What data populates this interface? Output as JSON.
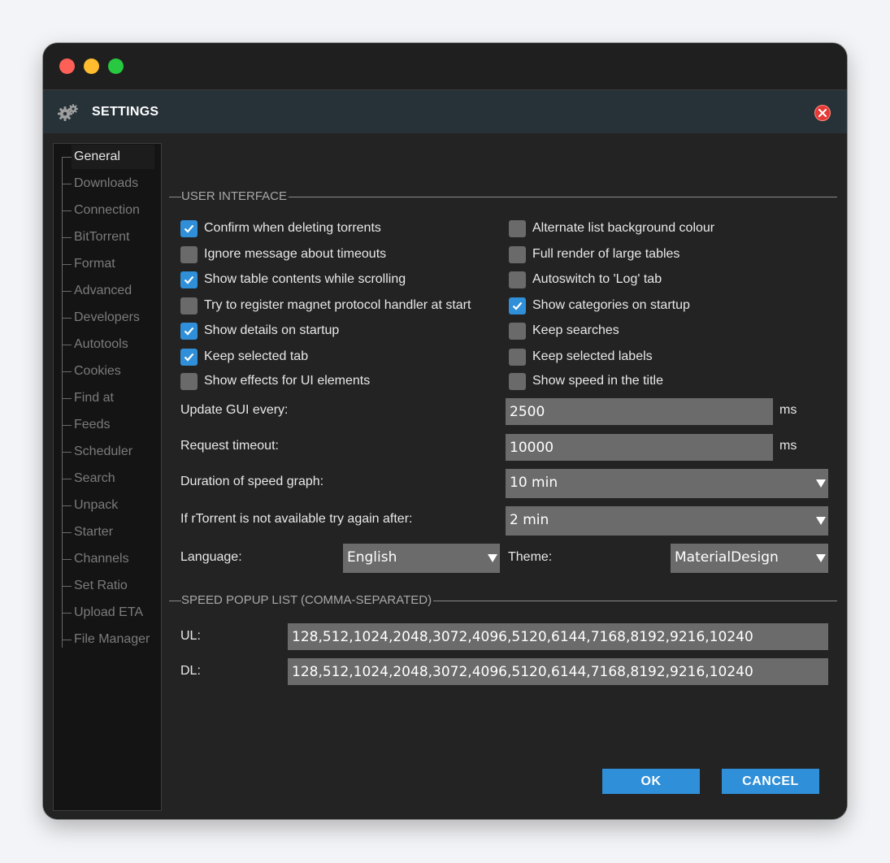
{
  "dialog": {
    "title": "SETTINGS"
  },
  "sidebar": {
    "items": [
      "General",
      "Downloads",
      "Connection",
      "BitTorrent",
      "Format",
      "Advanced",
      "Developers",
      "Autotools",
      "Cookies",
      "Find at",
      "Feeds",
      "Scheduler",
      "Search",
      "Unpack",
      "Starter",
      "Channels",
      "Set Ratio",
      "Upload ETA",
      "File Manager"
    ],
    "active": "General"
  },
  "user_interface": {
    "title": "USER INTERFACE",
    "left": [
      {
        "label": "Confirm when deleting torrents",
        "checked": true
      },
      {
        "label": "Ignore message about timeouts",
        "checked": false
      },
      {
        "label": "Show table contents while scrolling",
        "checked": true
      },
      {
        "label": "Try to register magnet protocol handler at start",
        "checked": false
      },
      {
        "label": "Show details on startup",
        "checked": true
      },
      {
        "label": "Keep selected tab",
        "checked": true
      },
      {
        "label": "Show effects for UI elements",
        "checked": false
      }
    ],
    "right": [
      {
        "label": "Alternate list background colour",
        "checked": false
      },
      {
        "label": "Full render of large tables",
        "checked": false
      },
      {
        "label": "Autoswitch to 'Log' tab",
        "checked": false
      },
      {
        "label": "Show categories on startup",
        "checked": true
      },
      {
        "label": "Keep searches",
        "checked": false
      },
      {
        "label": "Keep selected labels",
        "checked": false
      },
      {
        "label": "Show speed in the title",
        "checked": false
      }
    ],
    "update_gui": {
      "label": "Update GUI every:",
      "value": "2500",
      "unit": "ms"
    },
    "request_timeout": {
      "label": "Request timeout:",
      "value": "10000",
      "unit": "ms"
    },
    "speed_graph": {
      "label": "Duration of speed graph:",
      "value": "10 min"
    },
    "retry": {
      "label": "If rTorrent is not available try again after:",
      "value": "2 min"
    },
    "language": {
      "label": "Language:",
      "value": "English"
    },
    "theme": {
      "label": "Theme:",
      "value": "MaterialDesign"
    }
  },
  "speed_popup": {
    "title": "SPEED POPUP LIST (COMMA-SEPARATED)",
    "ul": {
      "label": "UL:",
      "value": "128,512,1024,2048,3072,4096,5120,6144,7168,8192,9216,10240"
    },
    "dl": {
      "label": "DL:",
      "value": "128,512,1024,2048,3072,4096,5120,6144,7168,8192,9216,10240"
    }
  },
  "buttons": {
    "ok": "OK",
    "cancel": "CANCEL"
  },
  "colors": {
    "accent": "#2f8fd8",
    "header": "#263238",
    "close": "#e53935"
  }
}
